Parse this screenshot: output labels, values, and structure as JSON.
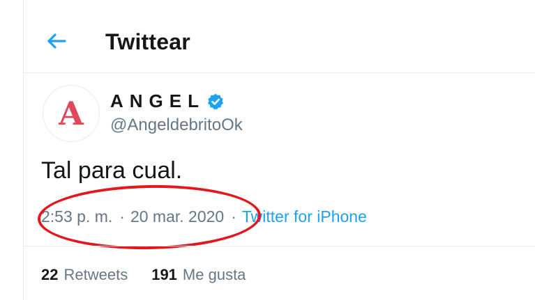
{
  "header": {
    "title": "Twittear",
    "back_icon": "arrow-left-icon"
  },
  "author": {
    "name": "ANGEL",
    "handle": "@AngeldebritoOk",
    "avatar_letter": "A",
    "verified_icon": "verified-badge-icon"
  },
  "tweet": {
    "text": "Tal para cual.",
    "time": "2:53 p. m.",
    "separator": "·",
    "date": "20 mar. 2020",
    "source_separator": "·",
    "source": "Twitter for iPhone"
  },
  "stats": [
    {
      "count": "22",
      "label": "Retweets"
    },
    {
      "count": "191",
      "label": "Me gusta"
    }
  ],
  "colors": {
    "accent": "#1da1f2",
    "text_primary": "#14171a",
    "text_secondary": "#657786",
    "avatar_letter": "#e0475a",
    "annotation_ellipse": "#e3171e",
    "border": "#e6ecf0"
  }
}
